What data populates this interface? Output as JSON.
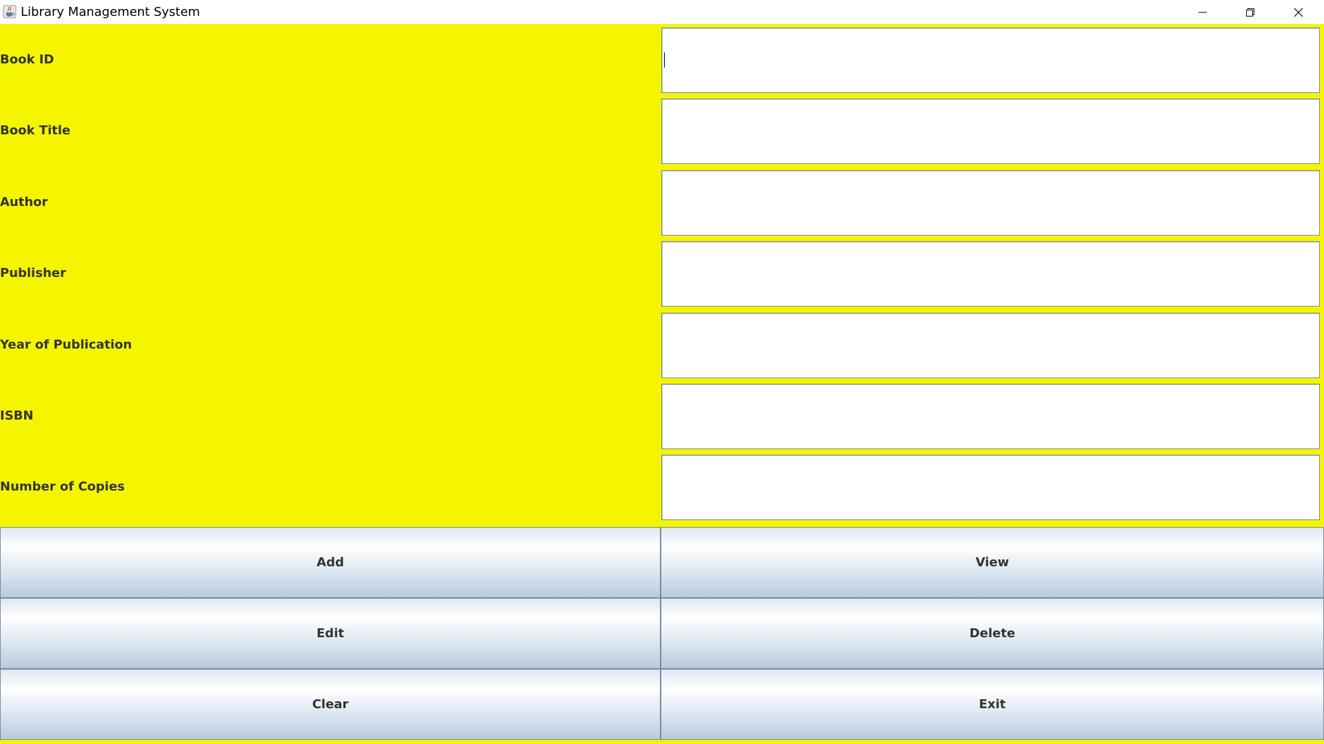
{
  "window": {
    "title": "Library Management System",
    "icon": "java-cup-icon"
  },
  "form": {
    "fields": [
      {
        "label": "Book ID",
        "value": ""
      },
      {
        "label": "Book Title",
        "value": ""
      },
      {
        "label": "Author",
        "value": ""
      },
      {
        "label": "Publisher",
        "value": ""
      },
      {
        "label": "Year of Publication",
        "value": ""
      },
      {
        "label": "ISBN",
        "value": ""
      },
      {
        "label": "Number of Copies",
        "value": ""
      }
    ]
  },
  "buttons": {
    "add": "Add",
    "view": "View",
    "edit": "Edit",
    "delete": "Delete",
    "clear": "Clear",
    "exit": "Exit"
  },
  "colors": {
    "background": "#f5f500",
    "label_text": "#333333",
    "input_border": "#7a8a99"
  }
}
